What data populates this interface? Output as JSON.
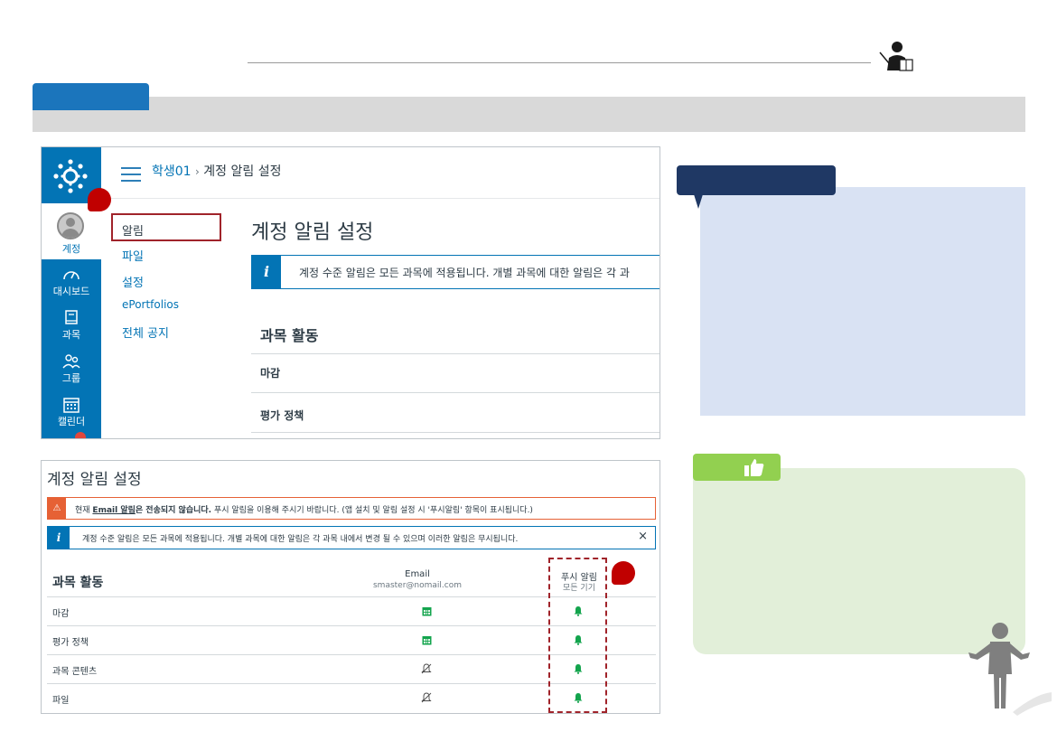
{
  "canvas_top": {
    "breadcrumb": {
      "user": "학생01",
      "separator": "›",
      "page": "계정 알림 설정"
    },
    "global_nav": [
      {
        "label": "계정",
        "icon": "account-avatar-icon"
      },
      {
        "label": "대시보드",
        "icon": "dashboard-icon"
      },
      {
        "label": "과목",
        "icon": "courses-icon"
      },
      {
        "label": "그룹",
        "icon": "groups-icon"
      },
      {
        "label": "캘린더",
        "icon": "calendar-icon"
      }
    ],
    "account_subnav": [
      "알림",
      "파일",
      "설정",
      "ePortfolios",
      "전체 공지"
    ],
    "page_title": "계정 알림 설정",
    "info_text": "계정 수준 알림은 모든 과목에 적용됩니다. 개별 과목에 대한 알림은 각 과",
    "section_title": "과목 활동",
    "rows": [
      "마감",
      "평가 정책"
    ]
  },
  "canvas_bottom": {
    "title": "계정 알림 설정",
    "warning_prefix": "현재 ",
    "warning_link": "Email 알림",
    "warning_bold": "은 전송되지 않습니다.",
    "warning_rest": " 푸시 알림을 이용해 주시기 바랍니다. (앱 설치 및 알림 설정 시 '푸시알림' 항목이 표시됩니다.)",
    "info_text": "계정 수준 알림은 모든 과목에 적용됩니다. 개별 과목에 대한 알림은 각 과목 내에서 변경 될 수 있으며 이러한 알림은 무시됩니다.",
    "close_label": "×",
    "section_title": "과목 활동",
    "col_email": "Email",
    "col_email_sub": "smaster@nomail.com",
    "col_push": "푸시 알림",
    "col_push_sub": "모든 기기",
    "rows": [
      {
        "label": "마감",
        "email": "calendar-icon",
        "push": "bell-icon"
      },
      {
        "label": "평가 정책",
        "email": "calendar-icon",
        "push": "bell-icon"
      },
      {
        "label": "과목 콘텐츠",
        "email": "bell-off-icon",
        "push": "bell-icon"
      },
      {
        "label": "파일",
        "email": "bell-off-icon",
        "push": "bell-icon"
      }
    ]
  },
  "colors": {
    "canvas_blue": "#0374b5",
    "highlight_red": "#a0232a",
    "callout_navy": "#1f3864",
    "tip_green": "#92d050",
    "enabled_green": "#13a44d"
  }
}
